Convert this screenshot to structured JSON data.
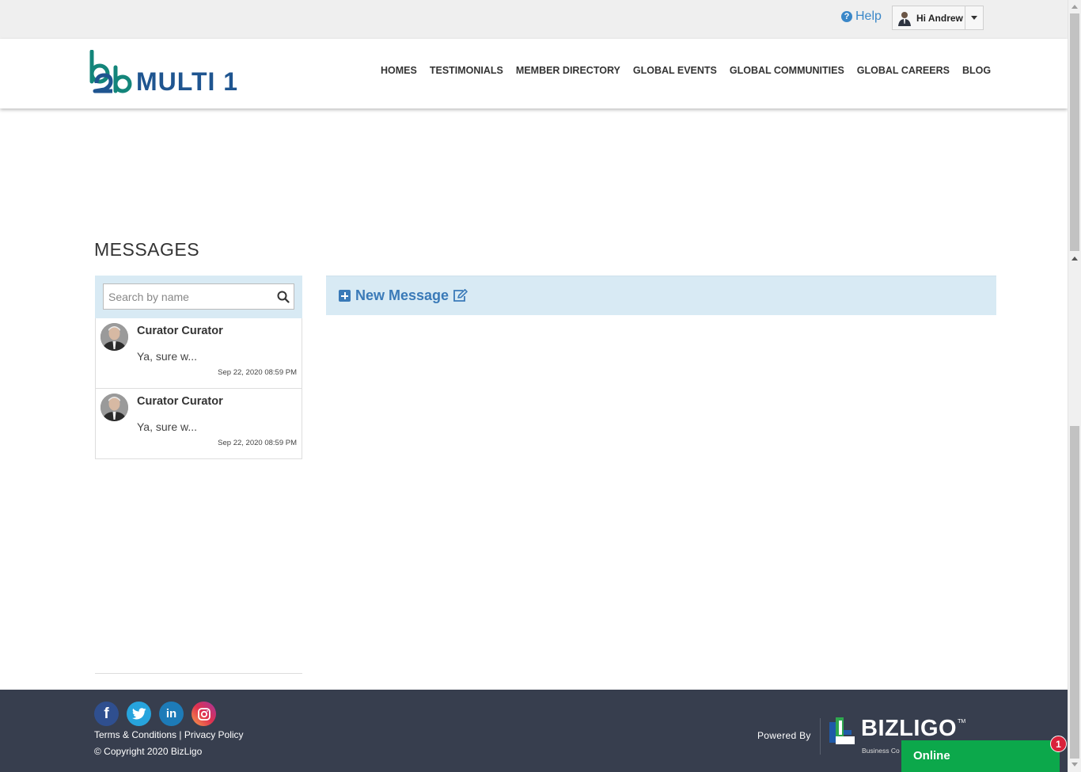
{
  "topbar": {
    "help_label": "Help",
    "help_icon": "question-circle-icon",
    "user_greeting": "Hi Andrew"
  },
  "header": {
    "logo_mark": "b2b",
    "logo_text": "MULTI 1",
    "nav": [
      {
        "label": "HOMES"
      },
      {
        "label": "TESTIMONIALS"
      },
      {
        "label": "MEMBER DIRECTORY"
      },
      {
        "label": "GLOBAL EVENTS"
      },
      {
        "label": "GLOBAL COMMUNITIES"
      },
      {
        "label": "GLOBAL CAREERS"
      },
      {
        "label": "BLOG"
      }
    ]
  },
  "page": {
    "title": "MESSAGES"
  },
  "sidebar": {
    "search": {
      "placeholder": "Search by name",
      "value": ""
    },
    "conversations": [
      {
        "name": "Curator Curator",
        "snippet": "Ya, sure w...",
        "date": "Sep 22, 2020 08:59 PM"
      },
      {
        "name": "Curator Curator",
        "snippet": "Ya, sure w...",
        "date": "Sep 22, 2020 08:59 PM"
      }
    ]
  },
  "main": {
    "new_message_label": "New Message"
  },
  "footer": {
    "social": [
      "facebook-icon",
      "twitter-icon",
      "linkedin-icon",
      "instagram-icon"
    ],
    "terms_label": "Terms & Conditions",
    "separator": "|",
    "privacy_label": "Privacy Policy",
    "copyright": "© Copyright 2020 BizLigo",
    "powered_by": "Powered By",
    "brand": "BIZLIGO",
    "brand_tm": "TM",
    "brand_sub": "Business Co"
  },
  "chat": {
    "label": "Online",
    "badge_count": "1"
  },
  "colors": {
    "accent": "#3a7ab8",
    "footer_bg": "#373e4e",
    "panel_bg": "#d8eaf4",
    "chat_green": "#0ca84b",
    "badge_red": "#d9223a",
    "logo_blue": "#1f5590",
    "logo_teal": "#13857a"
  }
}
